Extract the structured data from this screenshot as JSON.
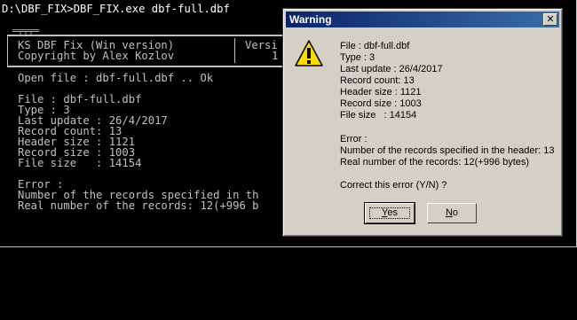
{
  "console": {
    "prompt_line": "D:\\DBF_FIX>DBF_FIX.exe dbf-full.dbf",
    "banner_tab": "═╤╤╤═",
    "banner_line1_left": "KS DBF Fix (Win version)",
    "banner_line1_right": "Versi",
    "banner_line2_left": "Copyright by Alex Kozlov",
    "banner_line2_right": "1",
    "open_file": "Open file : dbf-full.dbf .. Ok",
    "file": "File : dbf-full.dbf",
    "type": "Type : 3",
    "last_update": "Last update : 26/4/2017",
    "record_count": "Record count: 13",
    "header_size": "Header size : 1121",
    "record_size": "Record size : 1003",
    "file_size": "File size   : 14154",
    "error_label": "Error :",
    "error_line1": "Number of the records specified in th",
    "error_line2": "Real number of the records: 12(+996 b"
  },
  "dialog": {
    "title": "Warning",
    "close_glyph": "✕",
    "icon": "warning-icon",
    "file": "File : dbf-full.dbf",
    "type": "Type : 3",
    "last_update": "Last update : 26/4/2017",
    "record_count": "Record count: 13",
    "header_size": "Header size : 1121",
    "record_size": "Record size : 1003",
    "file_size": "File size   : 14154",
    "error_label": "Error :",
    "error_line1": "Number of the records specified in the header: 13",
    "error_line2": "Real number of the records: 12(+996 bytes)",
    "question": "Correct this error (Y/N) ?",
    "yes_mnemonic": "Y",
    "yes_rest": "es",
    "no_mnemonic": "N",
    "no_rest": "o"
  }
}
